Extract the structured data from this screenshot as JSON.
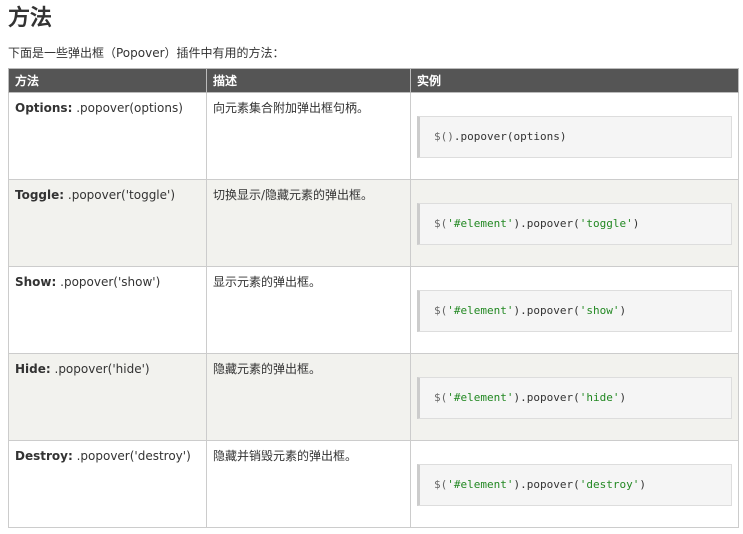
{
  "heading": "方法",
  "intro": "下面是一些弹出框（Popover）插件中有用的方法：",
  "table": {
    "headers": [
      "方法",
      "描述",
      "实例"
    ],
    "rows": [
      {
        "method_name": "Options:",
        "method_call": " .popover(options)",
        "description": "向元素集合附加弹出框句柄。",
        "code_prefix": "$()",
        "code_arg": "",
        "code_suffix": ".popover(options)"
      },
      {
        "method_name": "Toggle:",
        "method_call": " .popover('toggle')",
        "description": "切换显示/隐藏元素的弹出框。",
        "code_prefix": "$(",
        "code_arg": "'#element'",
        "code_suffix": ").popover(",
        "code_arg2": "'toggle'",
        "code_end": ")"
      },
      {
        "method_name": "Show:",
        "method_call": " .popover('show')",
        "description": "显示元素的弹出框。",
        "code_prefix": "$(",
        "code_arg": "'#element'",
        "code_suffix": ").popover(",
        "code_arg2": "'show'",
        "code_end": ")"
      },
      {
        "method_name": "Hide:",
        "method_call": " .popover('hide')",
        "description": "隐藏元素的弹出框。",
        "code_prefix": "$(",
        "code_arg": "'#element'",
        "code_suffix": ").popover(",
        "code_arg2": "'hide'",
        "code_end": ")"
      },
      {
        "method_name": "Destroy:",
        "method_call": " .popover('destroy')",
        "description": "隐藏并销毁元素的弹出框。",
        "code_prefix": "$(",
        "code_arg": "'#element'",
        "code_suffix": ").popover(",
        "code_arg2": "'destroy'",
        "code_end": ")"
      }
    ]
  }
}
